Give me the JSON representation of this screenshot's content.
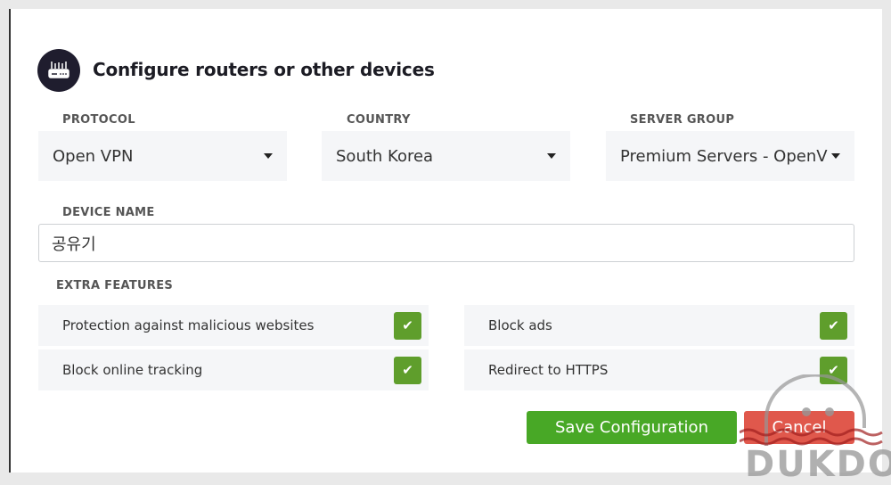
{
  "header": {
    "title": "Configure routers or other devices",
    "icon": "router-icon"
  },
  "fields": {
    "protocol": {
      "label": "PROTOCOL",
      "value": "Open VPN"
    },
    "country": {
      "label": "COUNTRY",
      "value": "South Korea"
    },
    "server_group": {
      "label": "SERVER GROUP",
      "value": "Premium Servers - OpenVPN"
    },
    "device_name": {
      "label": "DEVICE NAME",
      "value": "공유기"
    }
  },
  "extra_features": {
    "label": "EXTRA FEATURES",
    "items": [
      {
        "label": "Protection against malicious websites",
        "checked": true
      },
      {
        "label": "Block ads",
        "checked": true
      },
      {
        "label": "Block online tracking",
        "checked": true
      },
      {
        "label": "Redirect to HTTPS",
        "checked": true
      }
    ]
  },
  "buttons": {
    "save": "Save Configuration",
    "cancel": "Cancel"
  },
  "colors": {
    "save": "#48a826",
    "cancel": "#e0584c",
    "checkbox": "#5f9e2c",
    "icon_bg": "#1f1d2e"
  },
  "watermark": "DUKDO"
}
